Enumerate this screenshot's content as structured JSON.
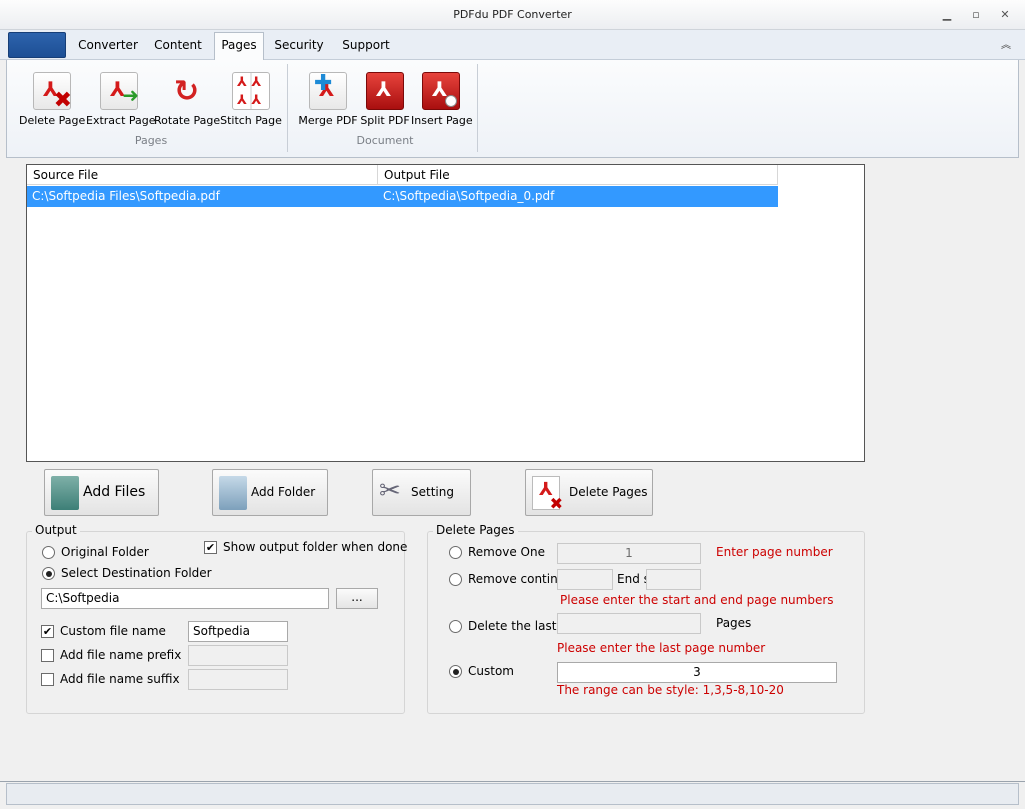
{
  "window": {
    "title": "PDFdu PDF Converter"
  },
  "tabs": [
    {
      "label": "Converter"
    },
    {
      "label": "Content"
    },
    {
      "label": "Pages"
    },
    {
      "label": "Security"
    },
    {
      "label": "Support"
    }
  ],
  "active_tab": "Pages",
  "ribbon": {
    "pages_group": {
      "label": "Pages",
      "buttons": [
        "Delete Page",
        "Extract Page",
        "Rotate Page",
        "Stitch Page"
      ]
    },
    "document_group": {
      "label": "Document",
      "buttons": [
        "Merge PDF",
        "Split PDF",
        "Insert Page"
      ]
    }
  },
  "file_list": {
    "columns": [
      "Source File",
      "Output File"
    ],
    "rows": [
      {
        "source": "C:\\Softpedia Files\\Softpedia.pdf",
        "output": "C:\\Softpedia\\Softpedia_0.pdf"
      }
    ]
  },
  "actions": {
    "add_files": "Add Files",
    "add_folder": "Add Folder",
    "setting": "Setting",
    "delete_pages": "Delete Pages"
  },
  "output": {
    "title": "Output",
    "original_folder": "Original Folder",
    "select_destination": "Select Destination Folder",
    "show_output": "Show output folder when done",
    "show_output_checked": true,
    "destination_selected": true,
    "folder_path": "C:\\Softpedia",
    "browse_label": "...",
    "custom_name_label": "Custom file name",
    "custom_name_checked": true,
    "custom_name_value": "Softpedia",
    "prefix_label": "Add file name prefix",
    "prefix_checked": false,
    "suffix_label": "Add file name suffix",
    "suffix_checked": false
  },
  "delete_pages": {
    "title": "Delete Pages",
    "remove_one": "Remove One",
    "remove_one_value": "1",
    "remove_one_hint": "Enter page number",
    "remove_continuous": "Remove continu",
    "end_label": "End s",
    "range_hint": "Please enter the start and end page numbers",
    "delete_last": "Delete the last",
    "pages_label": "Pages",
    "last_hint": "Please enter the last page number",
    "custom": "Custom",
    "custom_value": "3",
    "custom_hint": "The range can be style: 1,3,5-8,10-20",
    "selected": "Custom"
  },
  "colors": {
    "selection": "#3399ff",
    "hint_red": "#cc0000",
    "app_button": "#1d4f95"
  }
}
